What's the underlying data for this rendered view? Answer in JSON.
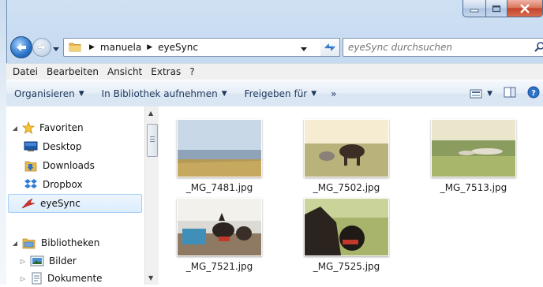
{
  "window": {
    "buttons": {
      "minimize": "minimize-icon",
      "maximize": "maximize-icon",
      "close": "close-icon"
    }
  },
  "address": {
    "breadcrumbs": [
      "manuela",
      "eyeSync"
    ],
    "search_placeholder": "eyeSync durchsuchen"
  },
  "menu": [
    "Datei",
    "Bearbeiten",
    "Ansicht",
    "Extras",
    "?"
  ],
  "toolbar": {
    "organize": "Organisieren",
    "include": "In Bibliothek aufnehmen",
    "share": "Freigeben für",
    "more": "»"
  },
  "nav": {
    "favorites": "Favoriten",
    "desktop": "Desktop",
    "downloads": "Downloads",
    "dropbox": "Dropbox",
    "eyesync": "eyeSync",
    "libraries": "Bibliotheken",
    "pictures": "Bilder",
    "documents": "Dokumente"
  },
  "files": [
    {
      "name": "_MG_7481.jpg"
    },
    {
      "name": "_MG_7502.jpg"
    },
    {
      "name": "_MG_7513.jpg"
    },
    {
      "name": "_MG_7521.jpg"
    },
    {
      "name": "_MG_7525.jpg"
    }
  ],
  "colors": {
    "selection": "#dbedfd",
    "toolbar_text": "#1e395b",
    "accent": "#2b73c9"
  }
}
